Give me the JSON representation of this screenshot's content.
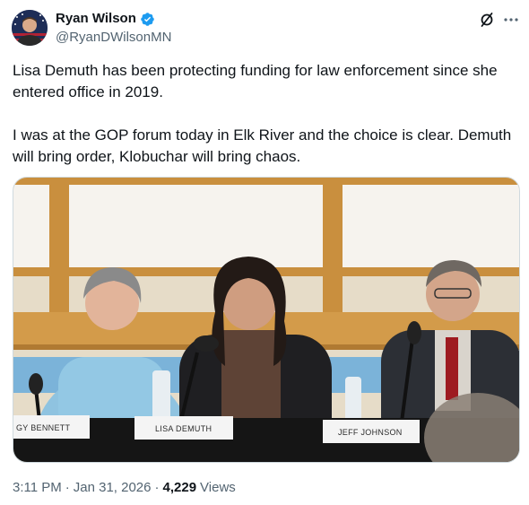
{
  "author": {
    "display_name": "Ryan Wilson",
    "handle": "@RyanDWilsonMN",
    "verified": true
  },
  "icons": {
    "verified": "verified-badge-icon",
    "grok": "grok-icon",
    "more": "more-icon"
  },
  "colors": {
    "verified_blue": "#1d9bf0",
    "secondary_text": "#536471",
    "primary_text": "#0f1419"
  },
  "tweet": {
    "paragraph_1": "Lisa Demuth has been protecting funding for law enforcement since she entered office in 2019.",
    "paragraph_2": "I was at the GOP forum today in Elk River and the choice is clear. Demuth will bring order, Klobuchar will bring chaos."
  },
  "media": {
    "placards": [
      "GY BENNETT",
      "LISA DEMUTH",
      "JEFF JOHNSON"
    ]
  },
  "meta": {
    "time": "3:11 PM",
    "separator": "·",
    "date": "Jan 31, 2026",
    "views_count": "4,229",
    "views_label": "Views"
  }
}
